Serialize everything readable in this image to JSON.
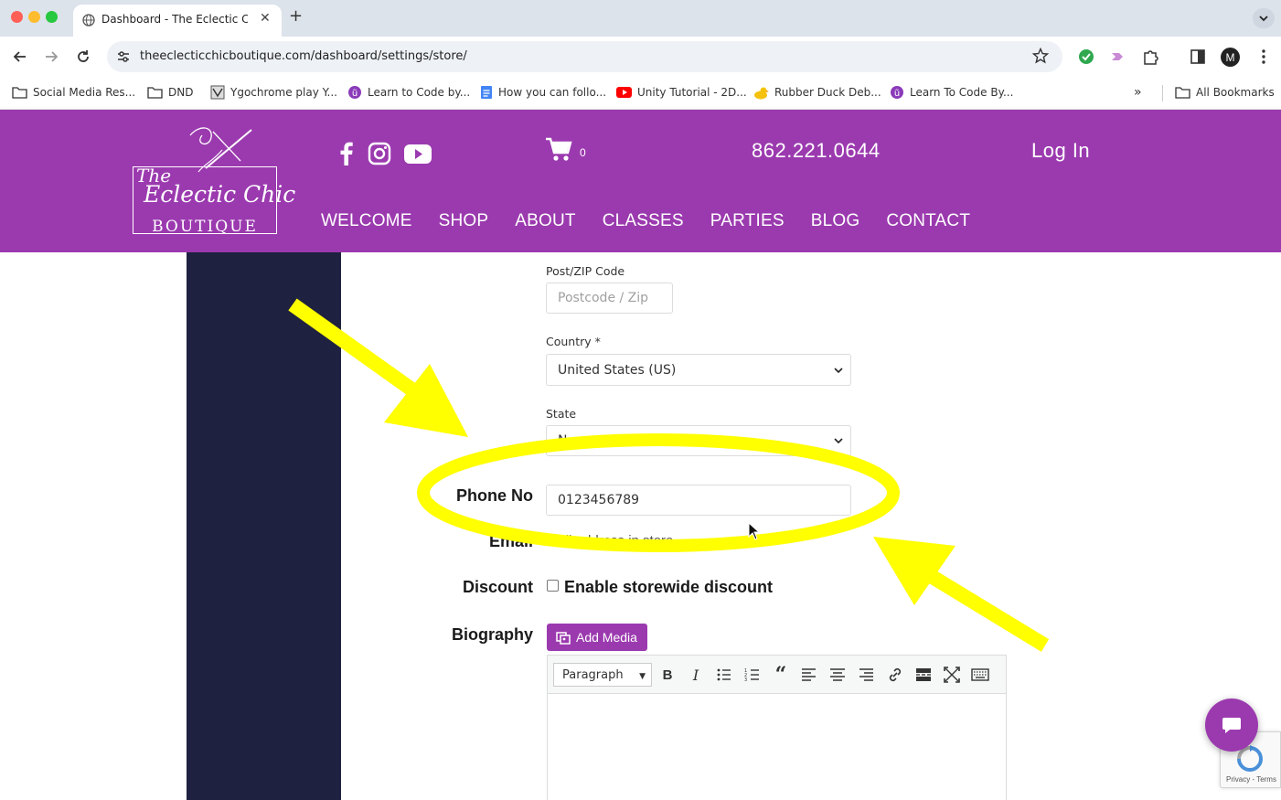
{
  "browser": {
    "tab_title": "Dashboard - The Eclectic Chic",
    "url": "theeclecticchicboutique.com/dashboard/settings/store/",
    "profile_initial": "M",
    "bookmarks": [
      {
        "label": "Social Media Res...",
        "icon": "folder-icon"
      },
      {
        "label": "DND",
        "icon": "folder-icon"
      },
      {
        "label": "Ygochrome play Y...",
        "icon": "site-icon"
      },
      {
        "label": "Learn to Code by...",
        "icon": "purple-circle-icon"
      },
      {
        "label": "How you can follo...",
        "icon": "doc-icon"
      },
      {
        "label": "Unity Tutorial - 2D...",
        "icon": "youtube-icon"
      },
      {
        "label": "Rubber Duck Deb...",
        "icon": "duck-icon"
      },
      {
        "label": "Learn To Code By...",
        "icon": "purple-circle-icon"
      }
    ],
    "all_bookmarks": "All Bookmarks",
    "overflow": "»"
  },
  "site": {
    "logo": {
      "the": "The",
      "main": "Eclectic Chic",
      "sub": "BOUTIQUE"
    },
    "cart_count": "0",
    "phone": "862.221.0644",
    "login": "Log In",
    "nav": [
      "WELCOME",
      "SHOP",
      "ABOUT",
      "CLASSES",
      "PARTIES",
      "BLOG",
      "CONTACT"
    ],
    "colors": {
      "brand": "#9b3aaf",
      "sidebar": "#1f2140"
    }
  },
  "form": {
    "zip_label": "Post/ZIP Code",
    "zip_placeholder": "Postcode / Zip",
    "country_label": "Country *",
    "country_value": "United States (US)",
    "state_label": "State",
    "state_value": "N",
    "phone_label": "Phone No",
    "phone_value": "0123456789",
    "email_label": "Email",
    "email_note": "mail address in store",
    "discount_label": "Discount",
    "discount_checkbox": "Enable storewide discount",
    "biography_label": "Biography",
    "add_media": "Add Media",
    "editor_format": "Paragraph"
  },
  "recaptcha": {
    "text": "Privacy - Terms"
  }
}
